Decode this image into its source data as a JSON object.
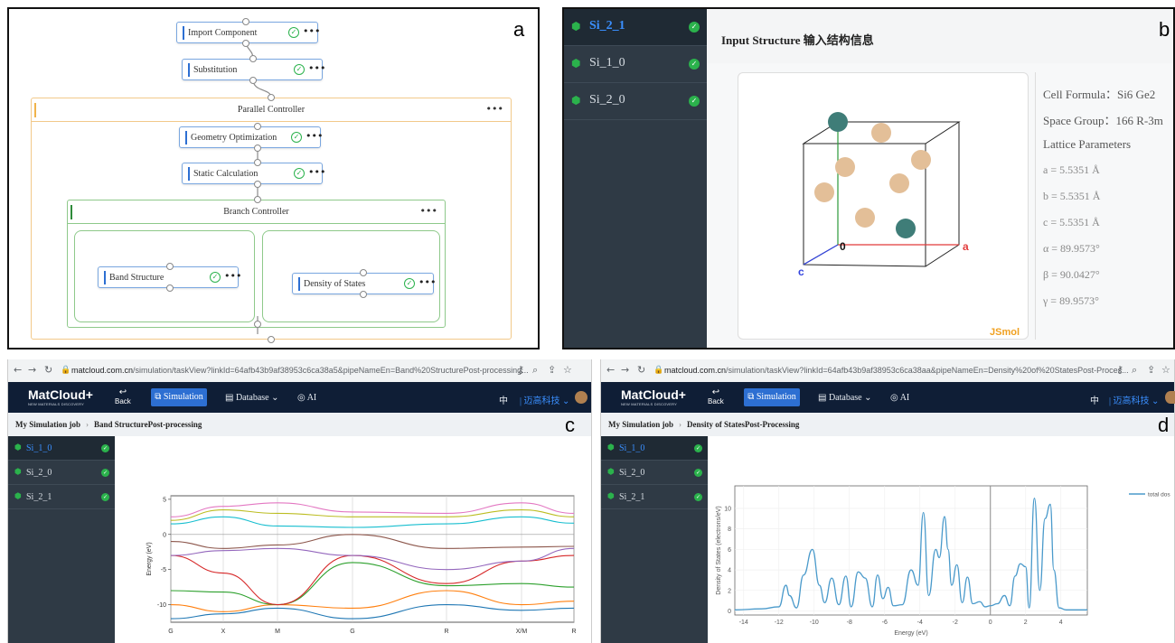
{
  "panels": {
    "a": "a",
    "b": "b",
    "c": "c",
    "d": "d"
  },
  "workflow": {
    "nodes": {
      "import": "Import Component",
      "substitution": "Substitution",
      "geometry": "Geometry Optimization",
      "static": "Static Calculation",
      "band": "Band Structure",
      "dos": "Density of States"
    },
    "controllers": {
      "parallel": "Parallel Controller",
      "branch": "Branch Controller"
    },
    "more": "•••",
    "check": "✓",
    "colors": {
      "node_border": "#7aa7e0",
      "node_bar": "#2d6fd2",
      "parallel": "#f2c98a",
      "branch": "#8ec98a",
      "check": "#2bb24c"
    }
  },
  "structure": {
    "items": [
      "Si_2_1",
      "Si_1_0",
      "Si_2_0"
    ],
    "active": "Si_2_1",
    "header": "Input Structure 输入结构信息",
    "viewer_brand": "JSmol",
    "axes": {
      "origin": "0",
      "a": "a",
      "c": "c"
    },
    "info": {
      "cell_formula": "Cell Formula：Si6 Ge2",
      "space_group": "Space Group：166 R-3m",
      "lattice": "Lattice Parameters",
      "a": "a = 5.5351 Å",
      "b": "b = 5.5351 Å",
      "c": "c = 5.5351 Å",
      "alpha": "α = 89.9573°",
      "beta": "β = 90.0427°",
      "gamma": "γ = 89.9573°"
    }
  },
  "browser_c": {
    "url_host": "matcloud.com.cn",
    "url_path": "/simulation/taskView?linkId=64afb43b9af38953c6ca38a5&pipeNameEn=Band%20StructurePost-processing...",
    "breadcrumb_root": "My Simulation job",
    "breadcrumb_page": "Band StructurePost-processing",
    "items": [
      "Si_1_0",
      "Si_2_0",
      "Si_2_1"
    ]
  },
  "browser_d": {
    "url_host": "matcloud.com.cn",
    "url_path": "/simulation/taskView?linkId=64afb43b9af38953c6ca38aa&pipeNameEn=Density%20of%20StatesPost-Proces...",
    "breadcrumb_root": "My Simulation job",
    "breadcrumb_page": "Density of StatesPost-Processing",
    "items": [
      "Si_1_0",
      "Si_2_0",
      "Si_2_1"
    ]
  },
  "app": {
    "logo": "MatCloud+",
    "logo_sub": "NEW MATERIALS DISCOVERY",
    "back": "Back",
    "simulation": "Simulation",
    "database": "Database",
    "ai": "AI",
    "lang": "中",
    "company": "迈高科技"
  },
  "chart_data": [
    {
      "type": "line",
      "ylabel": "Energy (eV)",
      "ylim": [
        -12.5,
        5.5
      ],
      "yticks": [
        5,
        0,
        -5,
        -10
      ],
      "xticks": [
        "G",
        "X",
        "M",
        "G",
        "R",
        "X/M",
        "R"
      ],
      "series": [
        {
          "values": [
            -12.0,
            -11.3,
            -10.5,
            -12.0,
            -10.0,
            -10.8,
            -10.5
          ]
        },
        {
          "values": [
            -10.0,
            -11.0,
            -10.0,
            -10.5,
            -8.0,
            -10.0,
            -9.5
          ]
        },
        {
          "values": [
            -8.0,
            -8.2,
            -10.0,
            -4.0,
            -7.3,
            -7.0,
            -7.5
          ]
        },
        {
          "values": [
            -3.0,
            -5.5,
            -10.0,
            -3.0,
            -7.0,
            -3.8,
            -3.0
          ]
        },
        {
          "values": [
            -3.0,
            -2.3,
            -2.0,
            -3.0,
            -5.0,
            -3.8,
            -2.0
          ]
        },
        {
          "values": [
            -1.0,
            -2.0,
            -1.5,
            0.0,
            -2.0,
            -1.8,
            -1.7
          ]
        },
        {
          "values": [
            2.5,
            4.0,
            4.5,
            3.2,
            3.0,
            4.5,
            3.0
          ]
        },
        {
          "values": [
            2.0,
            3.5,
            3.0,
            2.5,
            2.5,
            3.5,
            2.5
          ]
        },
        {
          "values": [
            1.5,
            2.5,
            1.2,
            1.0,
            1.5,
            2.5,
            1.6
          ]
        }
      ]
    },
    {
      "type": "line",
      "ylabel": "Density of States (electrons/eV)",
      "xlabel": "Energy (eV)",
      "xlim": [
        -14.5,
        5.5
      ],
      "ylim": [
        -0.4,
        12.2
      ],
      "xticks": [
        -14,
        -12,
        -10,
        -8,
        -6,
        -4,
        -2,
        0,
        2,
        4
      ],
      "yticks": [
        0,
        2,
        4,
        6,
        8,
        10
      ],
      "series": [
        {
          "name": "total dos",
          "x": [
            -14.5,
            -13,
            -12,
            -11.6,
            -11.4,
            -11.0,
            -10.6,
            -10.1,
            -9.7,
            -9.4,
            -9.0,
            -8.6,
            -8.2,
            -7.9,
            -7.5,
            -7.1,
            -6.7,
            -6.4,
            -6.1,
            -5.8,
            -5.5,
            -5.0,
            -4.5,
            -4.1,
            -3.8,
            -3.5,
            -3.1,
            -2.9,
            -2.6,
            -2.4,
            -2.2,
            -1.9,
            -1.6,
            -1.3,
            -1.0,
            -0.6,
            -0.3,
            0.0,
            0.4,
            0.8,
            1.1,
            1.4,
            1.7,
            2.0,
            2.2,
            2.5,
            2.8,
            3.1,
            3.4,
            3.6,
            3.9,
            4.3,
            5.5
          ],
          "y": [
            0.1,
            0.2,
            0.4,
            2.5,
            1.5,
            0.3,
            3.5,
            6.0,
            2.5,
            0.8,
            3.2,
            0.6,
            3.4,
            0.4,
            3.8,
            3.2,
            0.4,
            3.5,
            1.2,
            2.3,
            0.5,
            0.6,
            4.0,
            2.5,
            9.6,
            1.5,
            6.0,
            5.2,
            9.2,
            6.0,
            2.5,
            4.5,
            0.8,
            3.3,
            0.7,
            0.9,
            0.4,
            0.5,
            0.7,
            1.5,
            0.5,
            3.4,
            4.6,
            4.3,
            0.3,
            11.0,
            2.0,
            9.0,
            10.4,
            4.0,
            0.3,
            0.1,
            0.1
          ]
        }
      ]
    }
  ]
}
